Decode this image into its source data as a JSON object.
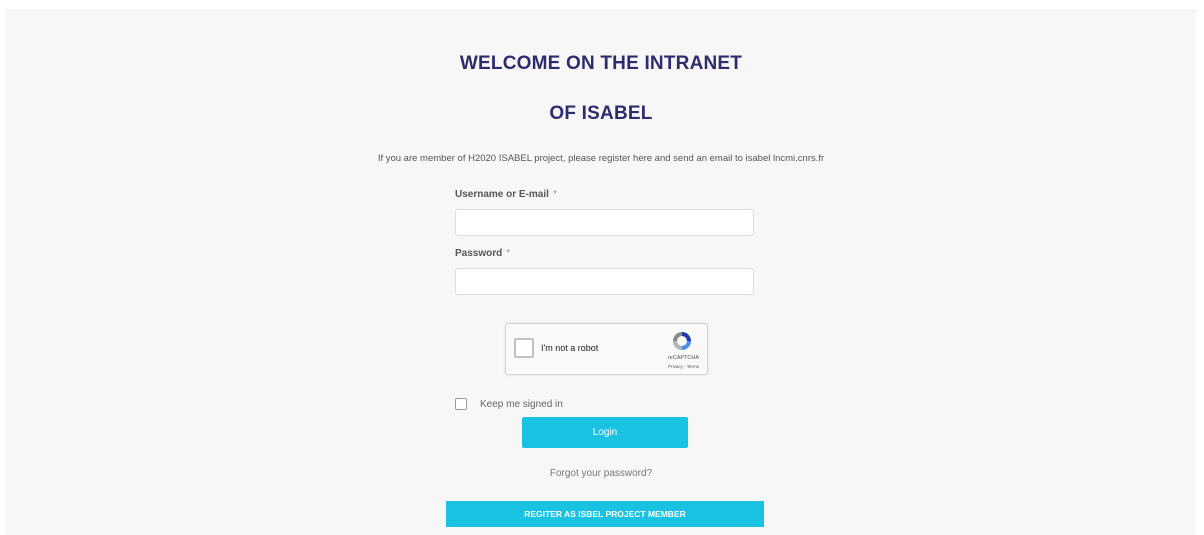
{
  "header": {
    "title_line1": "WELCOME ON THE INTRANET",
    "title_line2": "OF ISABEL"
  },
  "intro_text": "If you are member of H2020 ISABEL project, please register here and send an email to isabel lncmi.cnrs.fr",
  "form": {
    "username_label": "Username or E-mail",
    "password_label": "Password",
    "required_mark": "*",
    "username_value": "",
    "password_value": "",
    "keep_signed_in_label": "Keep me signed in",
    "keep_signed_in_checked": false,
    "login_label": "Login",
    "forgot_password_label": "Forgot your password?"
  },
  "captcha": {
    "label": "I'm not a robot",
    "brand": "reCAPTCHA",
    "terms": "Privacy - Terms",
    "checked": false
  },
  "register_label": "REGITER AS ISBEL PROJECT MEMBER",
  "colors": {
    "title": "#2e2c6e",
    "accent": "#1ac2e1",
    "background": "#f7f7f7"
  }
}
